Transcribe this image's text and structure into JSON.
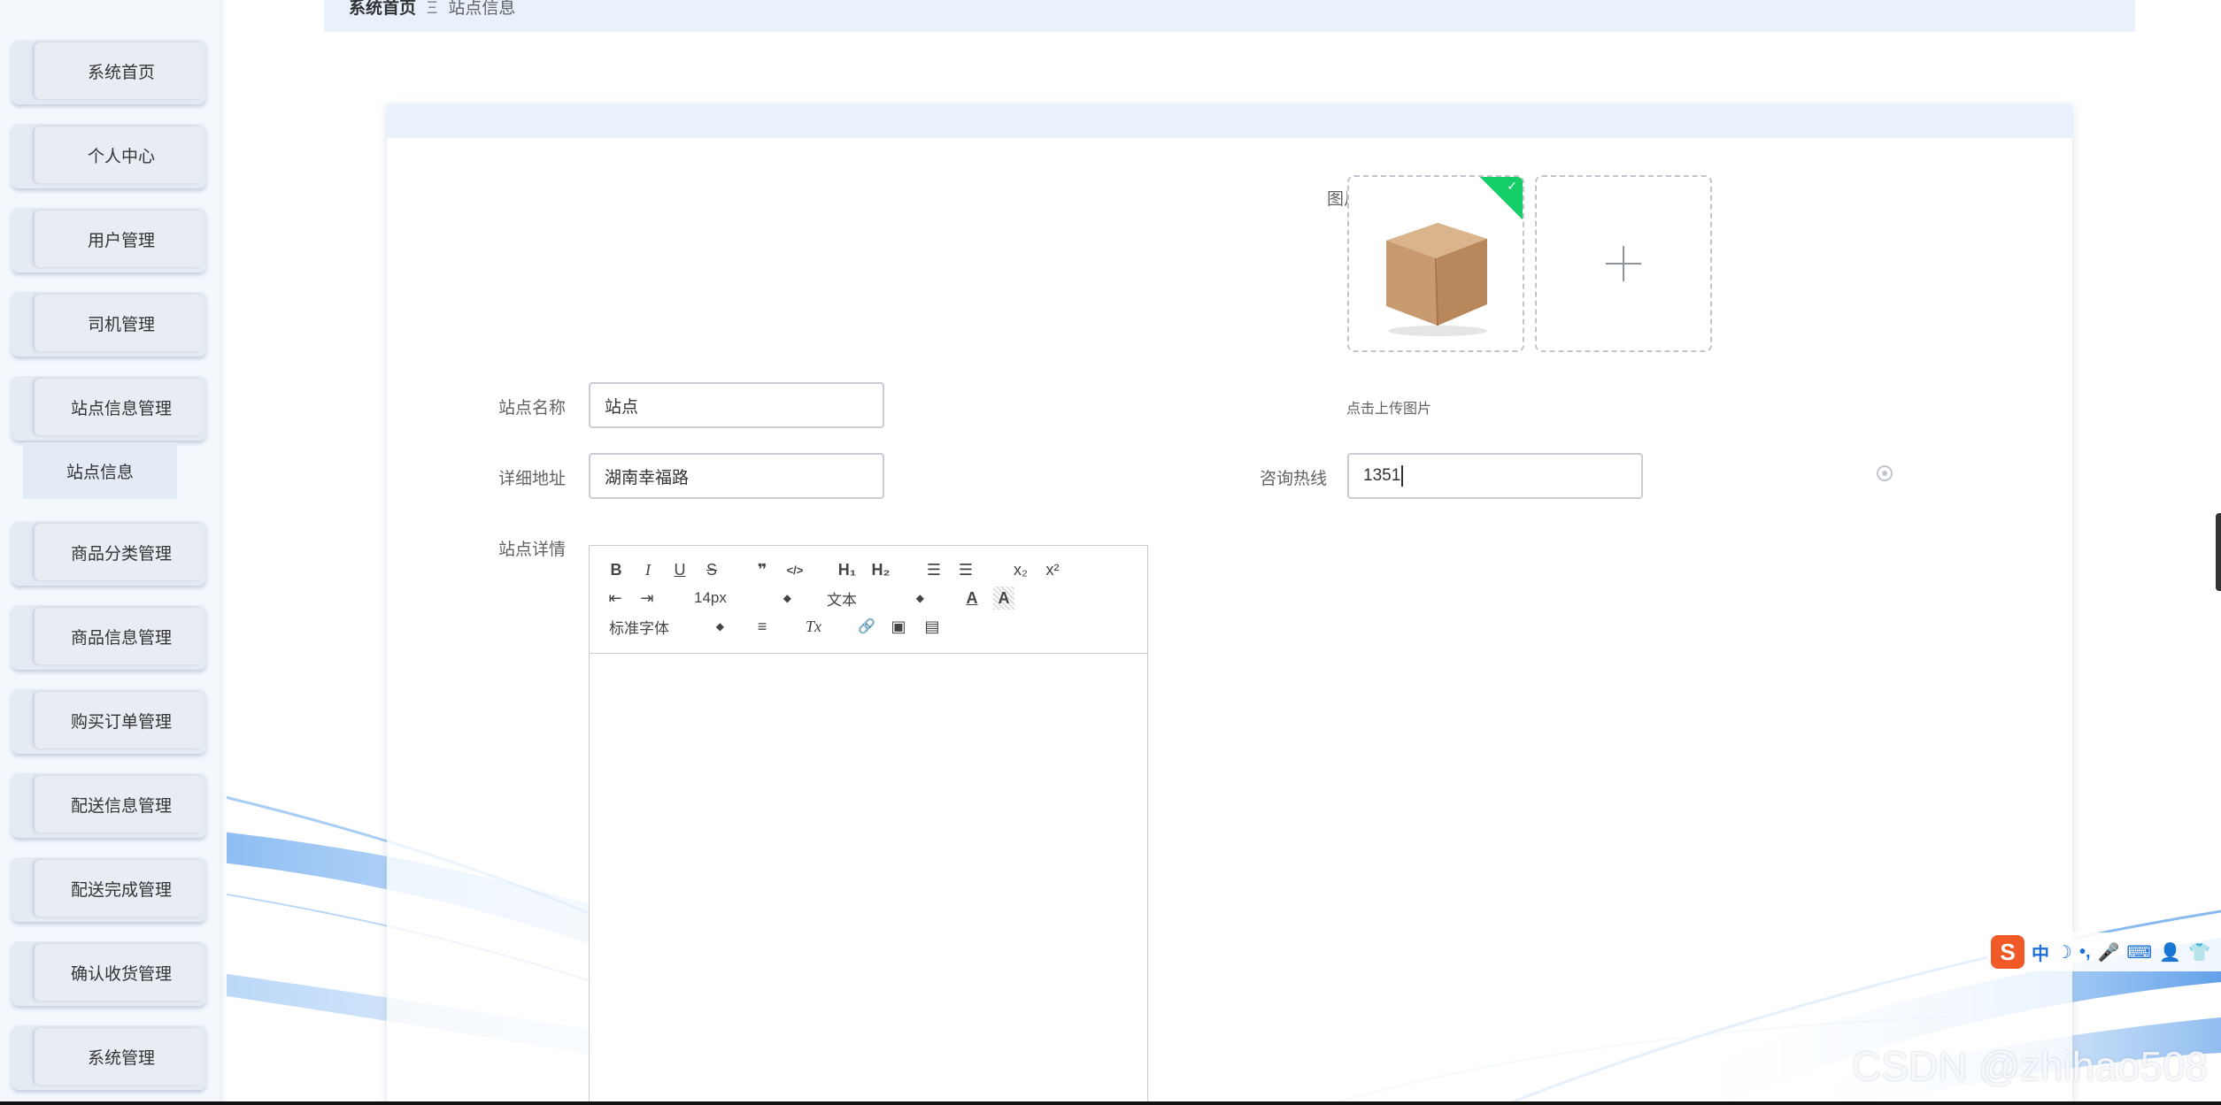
{
  "breadcrumb": {
    "home": "系统首页",
    "separator": "Ξ",
    "current": "站点信息"
  },
  "sidebar": {
    "items": [
      {
        "label": "系统首页"
      },
      {
        "label": "个人中心"
      },
      {
        "label": "用户管理"
      },
      {
        "label": "司机管理"
      },
      {
        "label": "站点信息管理"
      },
      {
        "label": "商品分类管理"
      },
      {
        "label": "商品信息管理"
      },
      {
        "label": "购买订单管理"
      },
      {
        "label": "配送信息管理"
      },
      {
        "label": "配送完成管理"
      },
      {
        "label": "确认收货管理"
      },
      {
        "label": "系统管理"
      }
    ],
    "submenu": {
      "label": "站点信息"
    }
  },
  "form": {
    "image_label": "图片",
    "upload_tip": "点击上传图片",
    "name_label": "站点名称",
    "name_value": "站点",
    "address_label": "详细地址",
    "address_value": "湖南幸福路",
    "hotline_label": "咨询热线",
    "hotline_value": "1351",
    "detail_label": "站点详情"
  },
  "editor": {
    "font_size": "14px",
    "header_picker": "文本",
    "font_family": "标准字体",
    "buttons": {
      "bold": "B",
      "italic": "I",
      "underline": "U",
      "strike": "S",
      "blockquote": "❞",
      "code": "</>",
      "h1": "H₁",
      "h2": "H₂",
      "ordered_list": "☰",
      "bullet_list": "☰",
      "subscript": "x₂",
      "superscript": "x²",
      "indent_dec": "⇤",
      "indent_inc": "⇥",
      "color": "A",
      "background": "A",
      "align": "≡",
      "clean": "Tx",
      "link": "🔗",
      "image": "▣",
      "video": "▤"
    }
  },
  "ime": {
    "logo": "S",
    "items": [
      "中",
      "☽",
      "•,",
      "🎤",
      "⌨",
      "👤",
      "👕"
    ]
  },
  "watermark": "CSDN @zhihao508",
  "colors": {
    "accent": "#13ce66",
    "breadcrumb_bg": "#e8f1fc",
    "sidebar_bg": "#f4f8fd",
    "wave": "#2f86e8"
  }
}
